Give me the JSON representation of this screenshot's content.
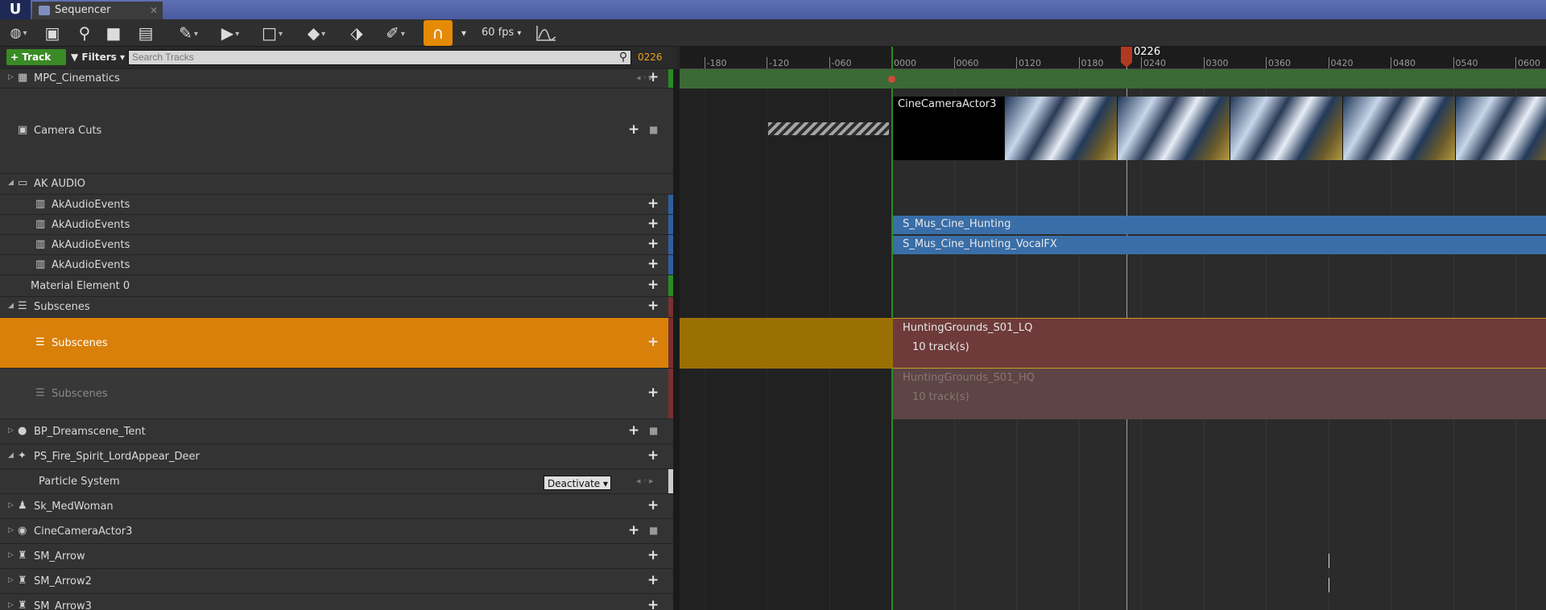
{
  "window": {
    "tab_title": "Sequencer",
    "tab_close": "✕",
    "logo": "U"
  },
  "toolbar": {
    "fps_label": "60 fps",
    "dropdown_glyph": "▾",
    "icons": [
      "world-icon",
      "save-icon",
      "search-icon",
      "camera-icon",
      "clapperboard-icon",
      "wrench-icon",
      "play-icon",
      "selection-icon",
      "keyframe-icon",
      "tag-icon",
      "pencil-icon",
      "snap-magnet-icon",
      "graph-editor-icon"
    ]
  },
  "filter_bar": {
    "add_track_label": "+ Track",
    "filters_label": "Filters",
    "search_placeholder": "Search Tracks",
    "current_frame": "0226"
  },
  "timeline": {
    "playhead_label": "0226",
    "ticks": [
      "-180",
      "-120",
      "-060",
      "0000",
      "0060",
      "0120",
      "0180",
      "0240",
      "0300",
      "0360",
      "0420",
      "0480",
      "0540",
      "0600"
    ]
  },
  "tracks": [
    {
      "label": "MPC_Cinematics"
    },
    {
      "label": "Camera Cuts"
    },
    {
      "label": "AK AUDIO"
    },
    {
      "label": "AkAudioEvents"
    },
    {
      "label": "AkAudioEvents"
    },
    {
      "label": "AkAudioEvents"
    },
    {
      "label": "AkAudioEvents"
    },
    {
      "label": "Material Element 0"
    },
    {
      "label": "Subscenes"
    },
    {
      "label": "Subscenes"
    },
    {
      "label": "Subscenes"
    },
    {
      "label": "BP_Dreamscene_Tent"
    },
    {
      "label": "PS_Fire_Spirit_LordAppear_Deer"
    },
    {
      "label": "Particle System",
      "dropdown_value": "Deactivate"
    },
    {
      "label": "Sk_MedWoman"
    },
    {
      "label": "CineCameraActor3"
    },
    {
      "label": "SM_Arrow"
    },
    {
      "label": "SM_Arrow2"
    },
    {
      "label": "SM_Arrow3"
    }
  ],
  "sections": {
    "camera_cut": "CineCameraActor3",
    "audio_1": "S_Mus_Cine_Hunting",
    "audio_2": "S_Mus_Cine_Hunting_VocalFX",
    "subscene_1_name": "HuntingGrounds_S01_LQ",
    "subscene_1_tracks": "10 track(s)",
    "subscene_2_name": "HuntingGrounds_S01_HQ",
    "subscene_2_tracks": "10 track(s)"
  },
  "colors": {
    "accent": "#e48a06",
    "selected_row": "#d9800a",
    "audio_section": "#3a6ea8",
    "subscene_section": "#6e3a3a",
    "green": "#3a8a25"
  }
}
